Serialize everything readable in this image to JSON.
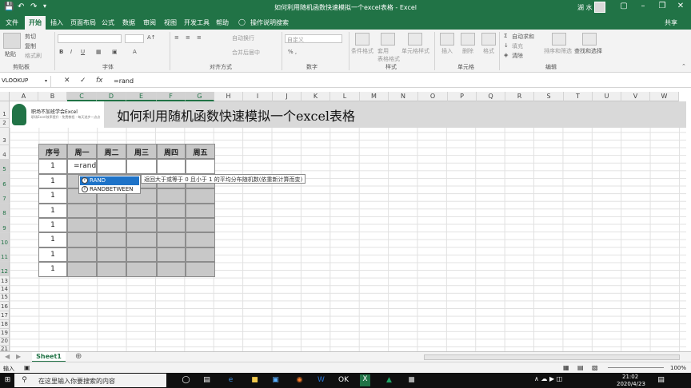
{
  "titlebar": {
    "title": "如何利用随机函数快速模拟一个excel表格 - Excel",
    "user": "湖 水",
    "quick_save_icon": "save-icon",
    "undo_icon": "undo-icon",
    "redo_icon": "redo-icon"
  },
  "tabs": [
    "文件",
    "开始",
    "插入",
    "页面布局",
    "公式",
    "数据",
    "审阅",
    "视图",
    "开发工具",
    "帮助"
  ],
  "active_tab": "开始",
  "tell_me": "操作说明搜索",
  "share": "共享",
  "ribbon": {
    "clipboard": {
      "paste": "粘贴",
      "cut": "剪切",
      "copy": "复制",
      "format_painter": "格式刷",
      "label": "剪贴板"
    },
    "font": {
      "label": "字体",
      "bold": "B",
      "italic": "I",
      "underline": "U"
    },
    "alignment": {
      "wrap": "自动换行",
      "merge": "合并后居中",
      "label": "对齐方式"
    },
    "number": {
      "format": "自定义",
      "label": "数字"
    },
    "styles": {
      "conditional": "条件格式",
      "table": "套用\n表格格式",
      "cell": "单元格样式",
      "label": "样式"
    },
    "cells": {
      "insert": "插入",
      "delete": "删除",
      "format": "格式",
      "label": "单元格"
    },
    "editing": {
      "autosum": "自动求和",
      "fill": "填充",
      "clear": "清除",
      "sort": "排序和筛选",
      "find": "查找和选择",
      "label": "编辑"
    }
  },
  "formula_bar": {
    "name_box": "VLOOKUP",
    "cancel": "✕",
    "enter": "✓",
    "fx": "fx",
    "value": "=rand"
  },
  "columns": [
    "A",
    "B",
    "C",
    "D",
    "E",
    "F",
    "G",
    "H",
    "I",
    "J",
    "K",
    "L",
    "M",
    "N",
    "O",
    "P",
    "Q",
    "R",
    "S",
    "T",
    "U",
    "V",
    "W"
  ],
  "rows": [
    "1",
    "2",
    "3",
    "4",
    "5",
    "6",
    "7",
    "8",
    "9",
    "10",
    "11",
    "12",
    "13",
    "14",
    "15",
    "16",
    "17",
    "18",
    "19",
    "20",
    "21"
  ],
  "banner": {
    "logo_title": "职场不加班学会Excel",
    "logo_sub": "职场Excel效率提升 · 免费教程 · 每天进步一点点",
    "title": "如何利用随机函数快速模拟一个excel表格"
  },
  "table": {
    "headers": [
      "序号",
      "周一",
      "周二",
      "周三",
      "周四",
      "周五"
    ],
    "seq": [
      "1",
      "1",
      "1",
      "1",
      "1",
      "1",
      "1",
      "1"
    ],
    "editing_cell": "=rand"
  },
  "autocomplete": {
    "items": [
      "RAND",
      "RANDBETWEEN"
    ],
    "tooltip": "返回大于或等于 0 且小于 1 的平均分布随机数(依重新计算而变)"
  },
  "sheet_tabs": [
    "Sheet1"
  ],
  "status": {
    "mode": "输入",
    "zoom": "100%"
  },
  "taskbar": {
    "search_placeholder": "在这里输入你要搜索的内容",
    "time": "21:02",
    "date": "2020/4/23"
  }
}
